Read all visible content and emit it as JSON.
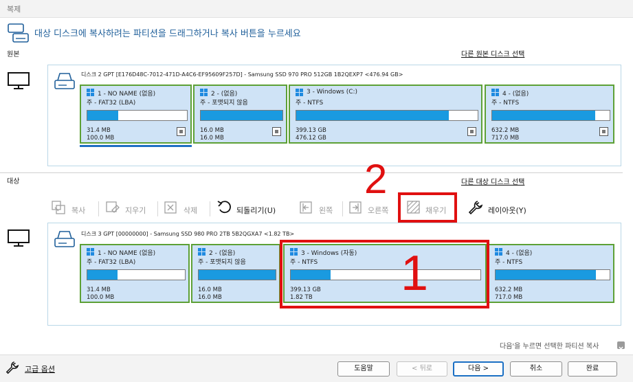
{
  "window": {
    "title": "복제"
  },
  "instruction": "대상 디스크에 복사하려는 파티션을 드래그하거나 복사 버튼을 누르세요",
  "source": {
    "label": "원본",
    "link": "다른 원본 디스크 선택",
    "disk_title": "디스크 2 GPT [E176D48C-7012-471D-A4C6-EF95609F257D] - Samsung SSD 970 PRO 512GB 1B2QEXP7  <476.94 GB>",
    "partitions": [
      {
        "name": "1 - NO NAME (없음)",
        "fs": "주 - FAT32 (LBA)",
        "used": "31.4 MB",
        "total": "100.0 MB",
        "fill": 0.31
      },
      {
        "name": "2 - (없음)",
        "fs": "주 - 포맷되지 않음",
        "used": "16.0 MB",
        "total": "16.0 MB",
        "fill": 1.0
      },
      {
        "name": "3 - Windows (C:)",
        "fs": "주 - NTFS",
        "used": "399.13 GB",
        "total": "476.12 GB",
        "fill": 0.84
      },
      {
        "name": "4 - (없음)",
        "fs": "주 - NTFS",
        "used": "632.2 MB",
        "total": "717.0 MB",
        "fill": 0.88
      }
    ]
  },
  "target": {
    "label": "대상",
    "link": "다른 대상 디스크 선택",
    "disk_title": "디스크 3 GPT [00000000] - Samsung SSD 980 PRO 2TB 5B2QGXA7  <1.82 TB>",
    "partitions": [
      {
        "name": "1 - NO NAME (없음)",
        "fs": "주 - FAT32 (LBA)",
        "used": "31.4 MB",
        "total": "100.0 MB",
        "fill": 0.31
      },
      {
        "name": "2 - (없음)",
        "fs": "주 - 포맷되지 않음",
        "used": "16.0 MB",
        "total": "16.0 MB",
        "fill": 1.0
      },
      {
        "name": "3 - Windows (자동)",
        "fs": "주 - NTFS",
        "used": "399.13 GB",
        "total": "1.82 TB",
        "fill": 0.21
      },
      {
        "name": "4 - (없음)",
        "fs": "주 - NTFS",
        "used": "632.2 MB",
        "total": "717.0 MB",
        "fill": 0.88
      }
    ]
  },
  "toolbar": {
    "copy": "복사",
    "clear": "지우기",
    "delete": "삭제",
    "undo": "되돌리기(U)",
    "left": "왼쪽",
    "right": "오른쪽",
    "fill": "채우기",
    "layout": "레이아웃(Y)"
  },
  "annotations": {
    "one": "1",
    "two": "2"
  },
  "hint": "다음'을 누르면 선택한 파티션 복사",
  "advanced": "고급 옵션",
  "buttons": {
    "help": "도움말",
    "back": "< 뒤로",
    "next": "다음 >",
    "cancel": "취소",
    "finish": "완료"
  },
  "colors": {
    "accent": "#1a9ae0",
    "partition_border": "#5da035",
    "annotation": "#e01010"
  }
}
